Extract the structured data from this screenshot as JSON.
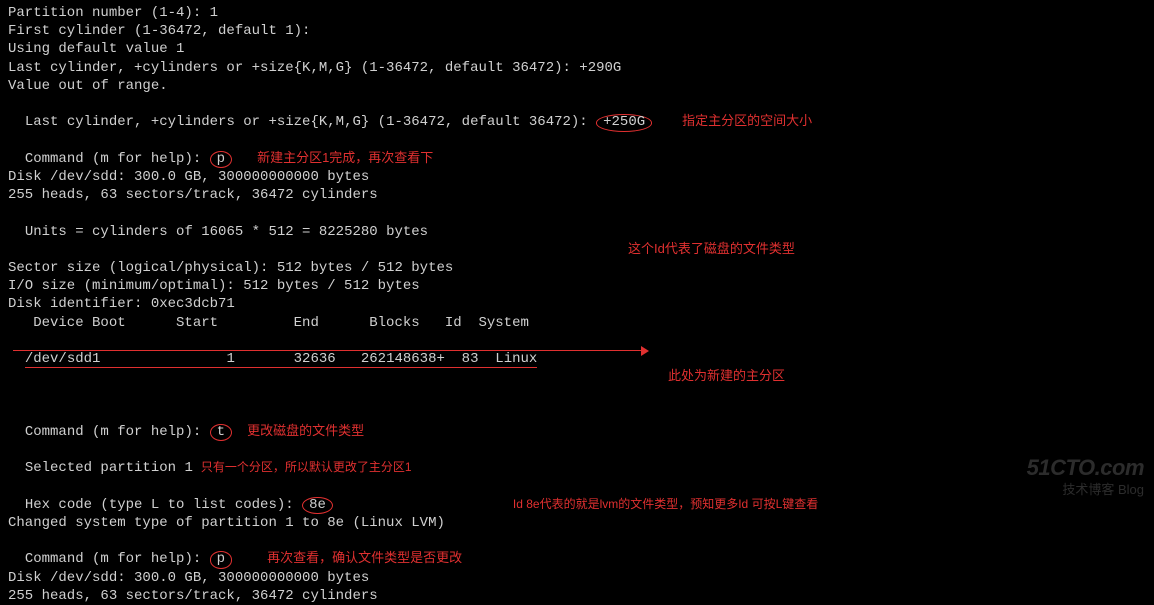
{
  "lines": {
    "l0": "Partition number (1-4): 1",
    "l1": "First cylinder (1-36472, default 1):",
    "l2": "Using default value 1",
    "l3": "Last cylinder, +cylinders or +size{K,M,G} (1-36472, default 36472): +290G",
    "l4": "Value out of range.",
    "l5a": "Last cylinder, +cylinders or +size{K,M,G} (1-36472, default 36472): ",
    "l5b": "+250G",
    "l6": "",
    "l7a": "Command (m for help): ",
    "l7b": "p",
    "l8": "",
    "l9": "Disk /dev/sdd: 300.0 GB, 300000000000 bytes",
    "l10": "255 heads, 63 sectors/track, 36472 cylinders",
    "l11": "Units = cylinders of 16065 * 512 = 8225280 bytes",
    "l12": "Sector size (logical/physical): 512 bytes / 512 bytes",
    "l13": "I/O size (minimum/optimal): 512 bytes / 512 bytes",
    "l14": "Disk identifier: 0xec3dcb71",
    "l15": "",
    "l16": "   Device Boot      Start         End      Blocks   Id  System",
    "l17": "/dev/sdd1               1       32636   262148638+  83  Linux",
    "l18": "",
    "l19a": "Command (m for help): ",
    "l19b": "t",
    "l20a": "Selected partition 1",
    "l21a": "Hex code (type L to list codes): ",
    "l21b": "8e",
    "l22": "Changed system type of partition 1 to 8e (Linux LVM)",
    "l23": "",
    "l24a": "Command (m for help): ",
    "l24b": "p",
    "l25": "",
    "l26": "Disk /dev/sdd: 300.0 GB, 300000000000 bytes",
    "l27": "255 heads, 63 sectors/track, 36472 cylinders"
  },
  "ann": {
    "a1": "指定主分区的空间大小",
    "a2": "新建主分区1完成，再次查看下",
    "a3": "这个Id代表了磁盘的文件类型",
    "a4": "此处为新建的主分区",
    "a5": "更改磁盘的文件类型",
    "a6": "只有一个分区，所以默认更改了主分区1",
    "a7": "Id 8e代表的就是lvm的文件类型，预知更多Id 可按L键查看",
    "a8": "再次查看，确认文件类型是否更改"
  },
  "watermark": {
    "top": "51CTO.com",
    "bot": "技术博客     Blog"
  }
}
